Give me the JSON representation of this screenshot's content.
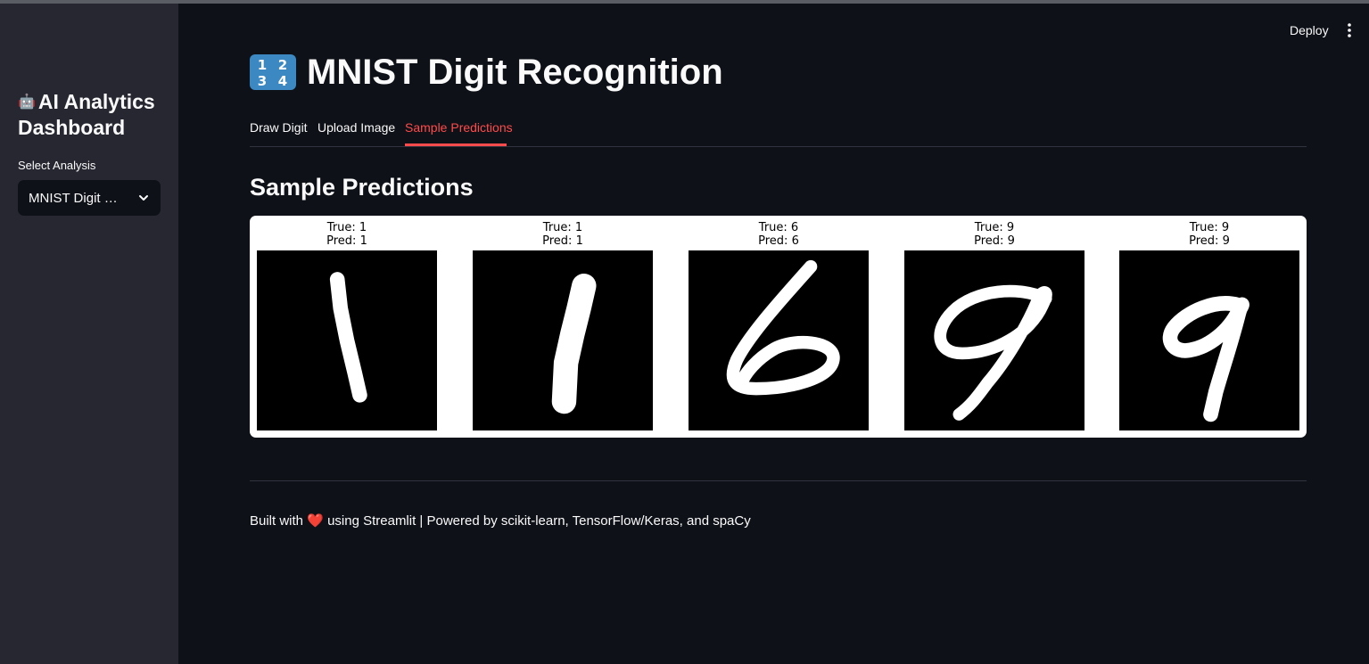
{
  "sidebar": {
    "title_emoji": "🤖",
    "title": "AI Analytics Dashboard",
    "select_label": "Select Analysis",
    "select_value": "MNIST Digit …",
    "icon": "chevron-down-icon"
  },
  "header": {
    "deploy_label": "Deploy",
    "menu_icon": "kebab-menu-icon"
  },
  "main": {
    "title_icon": "numbers-keycap-1234",
    "title": "MNIST Digit Recognition",
    "tabs": [
      {
        "label": "Draw Digit",
        "active": false
      },
      {
        "label": "Upload Image",
        "active": false
      },
      {
        "label": "Sample Predictions",
        "active": true
      }
    ],
    "section_title": "Sample Predictions",
    "samples": [
      {
        "true_label": "True: 1",
        "pred_label": "Pred: 1",
        "digit": 1
      },
      {
        "true_label": "True: 1",
        "pred_label": "Pred: 1",
        "digit": 1
      },
      {
        "true_label": "True: 6",
        "pred_label": "Pred: 6",
        "digit": 6
      },
      {
        "true_label": "True: 9",
        "pred_label": "Pred: 9",
        "digit": 9
      },
      {
        "true_label": "True: 9",
        "pred_label": "Pred: 9",
        "digit": 9
      }
    ]
  },
  "footer": {
    "prefix": "Built with",
    "heart": "❤️",
    "suffix": "using Streamlit | Powered by scikit-learn, TensorFlow/Keras, and spaCy"
  },
  "colors": {
    "background": "#0e1117",
    "sidebar": "#262730",
    "accent": "#ff4b4b",
    "text": "#fafafa"
  }
}
